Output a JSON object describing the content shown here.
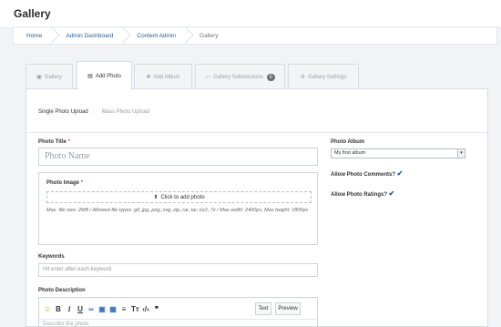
{
  "header": {
    "title": "Gallery"
  },
  "breadcrumb": [
    "Home",
    "Admin Dashboard",
    "Content Admin",
    "Gallery"
  ],
  "tabs": [
    {
      "label": "Gallery",
      "icon": "image-icon"
    },
    {
      "label": "Add Photo",
      "icon": "add-photo-icon"
    },
    {
      "label": "Add Album",
      "icon": "plus-icon"
    },
    {
      "label": "Gallery Submissions",
      "icon": "inbox-icon",
      "badge": "0"
    },
    {
      "label": "Gallery Settings",
      "icon": "cogs-icon"
    }
  ],
  "subtabs": [
    "Single Photo Upload",
    "Mass Photo Upload"
  ],
  "form": {
    "title_label": "Photo Title",
    "title_placeholder": "Photo Name",
    "image_label": "Photo Image",
    "dropzone_label": "Click to add photo",
    "help_text": "Max. file size: 2MB / Allowed file types: gif,.jpg,.png,.svg,.zip,.rar,.tar,.bz2,.7z / Max width: 2400px, Max height: 1800px",
    "keywords_label": "Keywords",
    "keywords_placeholder": "Hit enter after each keyword",
    "description_label": "Photo Description",
    "description_placeholder": "Describe the photo",
    "text_button": "Text",
    "preview_button": "Preview",
    "required_mark": "*"
  },
  "sidebar": {
    "album_label": "Photo Album",
    "album_value": "My first album",
    "comments_label": "Allow Photo Comments?",
    "ratings_label": "Allow Photo Ratings?"
  },
  "colors": {
    "link": "#2b5e8c",
    "required": "#d9534f",
    "background": "#f1f3f7"
  }
}
